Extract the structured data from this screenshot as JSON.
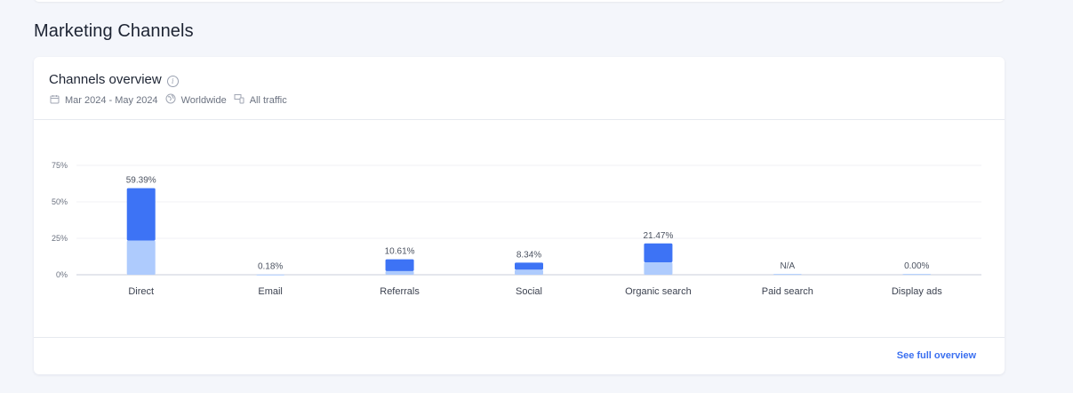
{
  "section": {
    "title": "Marketing Channels"
  },
  "card": {
    "title": "Channels overview",
    "date_range": "Mar 2024 - May 2024",
    "region": "Worldwide",
    "traffic": "All traffic",
    "link_label": "See full overview"
  },
  "icons": {
    "info": "info-icon",
    "calendar": "calendar-icon",
    "globe": "globe-icon",
    "traffic": "devices-icon"
  },
  "colors": {
    "primary_bar": "#3d73f5",
    "secondary_bar": "#aecbfd",
    "link": "#3a6ff0"
  },
  "chart_data": {
    "type": "bar",
    "stacked": true,
    "categories": [
      "Direct",
      "Email",
      "Referrals",
      "Social",
      "Organic search",
      "Paid search",
      "Display ads"
    ],
    "labels": [
      "59.39%",
      "0.18%",
      "10.61%",
      "8.34%",
      "21.47%",
      "N/A",
      "0.00%"
    ],
    "series": [
      {
        "values": [
          23.5,
          0.18,
          2.5,
          3.5,
          8.5,
          0.5,
          0.5
        ],
        "color": "#aecbfd"
      },
      {
        "values": [
          35.89,
          0,
          8.11,
          4.84,
          12.97,
          0,
          0
        ],
        "color": "#3d73f5"
      }
    ],
    "yticks": [
      "75%",
      "50%",
      "25%",
      "0%"
    ],
    "ylim": [
      0,
      75
    ],
    "grid": true
  }
}
